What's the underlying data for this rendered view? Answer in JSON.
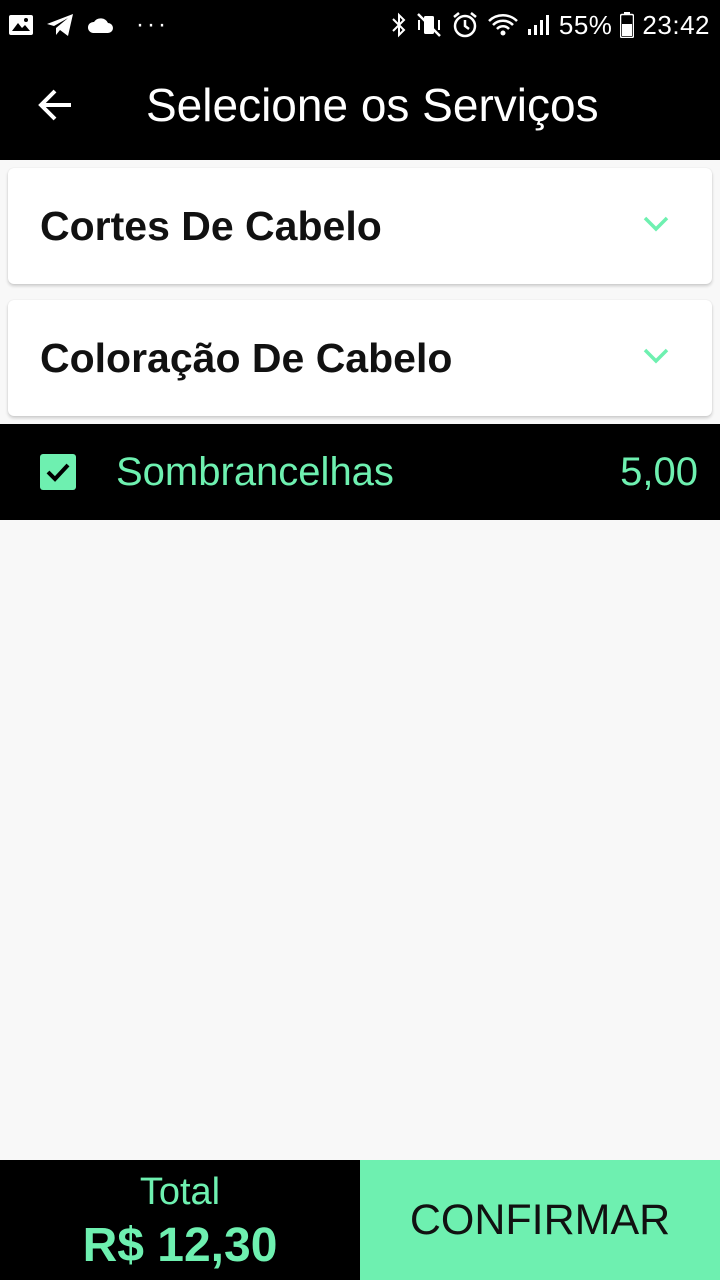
{
  "colors": {
    "accent": "#6ef0b0",
    "background": "#f8f8f8",
    "bar": "#000000"
  },
  "status_bar": {
    "left_icons": [
      "image-icon",
      "telegram-icon",
      "cloud-icon",
      "more-dots"
    ],
    "more": "···",
    "right_icons": [
      "bluetooth-icon",
      "vibrate-mute-icon",
      "alarm-icon",
      "wifi-icon",
      "signal-icon",
      "battery-icon"
    ],
    "battery": "55%",
    "time": "23:42"
  },
  "app_bar": {
    "back_icon": "arrow-back-icon",
    "title": "Selecione os Serviços"
  },
  "categories": [
    {
      "label": "Cortes De Cabelo",
      "icon": "chevron-down-icon"
    },
    {
      "label": "Coloração De Cabelo",
      "icon": "chevron-down-icon"
    }
  ],
  "selected_service": {
    "checked": true,
    "name": "Sombrancelhas",
    "price": "5,00"
  },
  "footer": {
    "total_label": "Total",
    "total_value": "R$ 12,30",
    "confirm_label": "CONFIRMAR"
  }
}
